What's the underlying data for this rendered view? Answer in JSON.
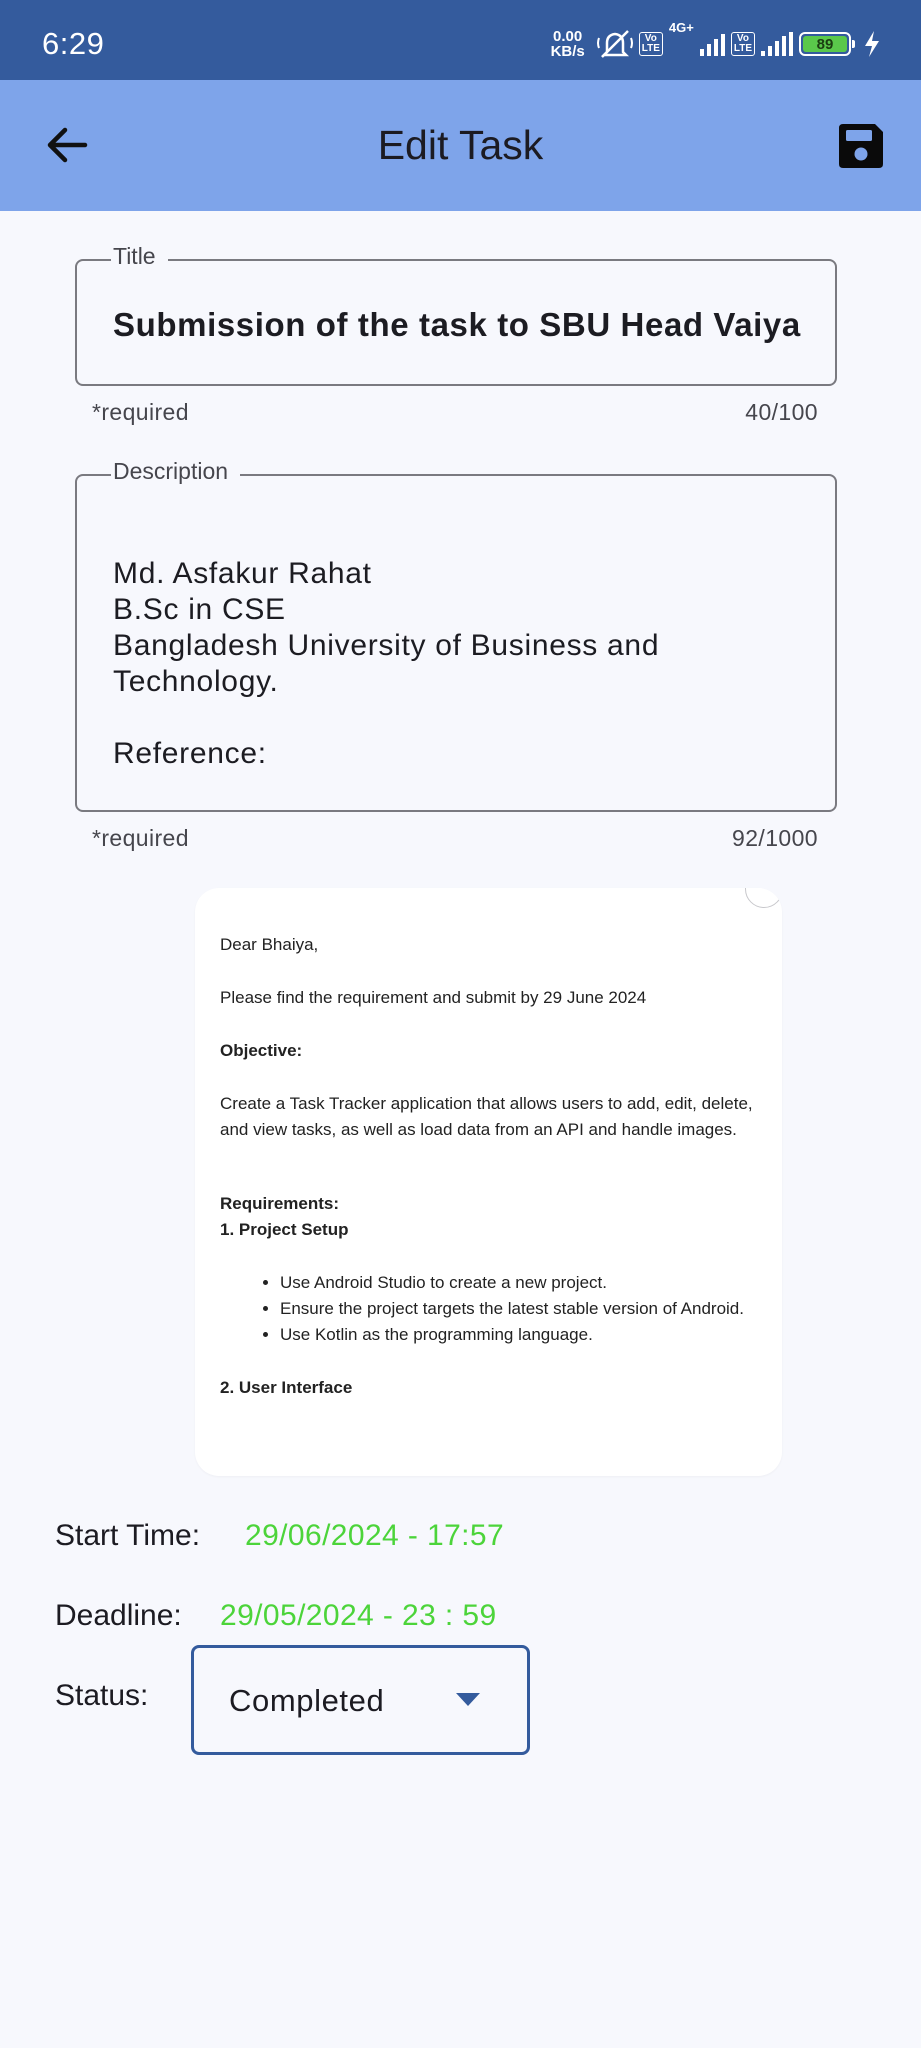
{
  "status_bar": {
    "time": "6:29",
    "net_speed_value": "0.00",
    "net_speed_unit": "KB/s",
    "volte_top": "Vo",
    "volte_bottom": "LTE",
    "network_type": "4G+",
    "battery_level": "89",
    "icons": [
      "mute-icon",
      "volte-icon",
      "signal-icon",
      "battery-icon",
      "charging-icon"
    ]
  },
  "app_bar": {
    "title": "Edit Task",
    "back_icon": "arrow-back-icon",
    "save_icon": "save-icon"
  },
  "form": {
    "title_field": {
      "label": "Title",
      "value": "Submission of the task to SBU Head Vaiya",
      "helper": "*required",
      "counter": "40/100"
    },
    "description_field": {
      "label": "Description",
      "value": "Md. Asfakur Rahat\nB.Sc in CSE\nBangladesh University of Business and Technology.\n\nReference:",
      "helper": "*required",
      "counter": "92/1000"
    }
  },
  "attachment": {
    "greeting": "Dear Bhaiya,",
    "intro": "Please find the requirement and submit by 29 June 2024",
    "objective_heading": "Objective:",
    "objective_text": "Create a Task Tracker application that allows users to add, edit, delete, and view tasks, as well as load data from an API and handle images.",
    "requirements_heading": "Requirements:",
    "section1_heading": "1. Project Setup",
    "section1_bullets": [
      "Use Android Studio to create a new project.",
      "Ensure the project targets the latest stable version of Android.",
      "Use Kotlin as the programming language."
    ],
    "section2_heading": "2. User Interface"
  },
  "details": {
    "start_label": "Start Time:",
    "start_value": "29/06/2024 - 17:57",
    "deadline_label": "Deadline:",
    "deadline_value": "29/05/2024 - 23 : 59",
    "status_label": "Status:",
    "status_value": "Completed"
  },
  "colors": {
    "status_bar": "#345b9d",
    "app_bar": "#7ea4ea",
    "background": "#f7f8fd",
    "date_green": "#4cd43a",
    "accent": "#345b9d"
  }
}
